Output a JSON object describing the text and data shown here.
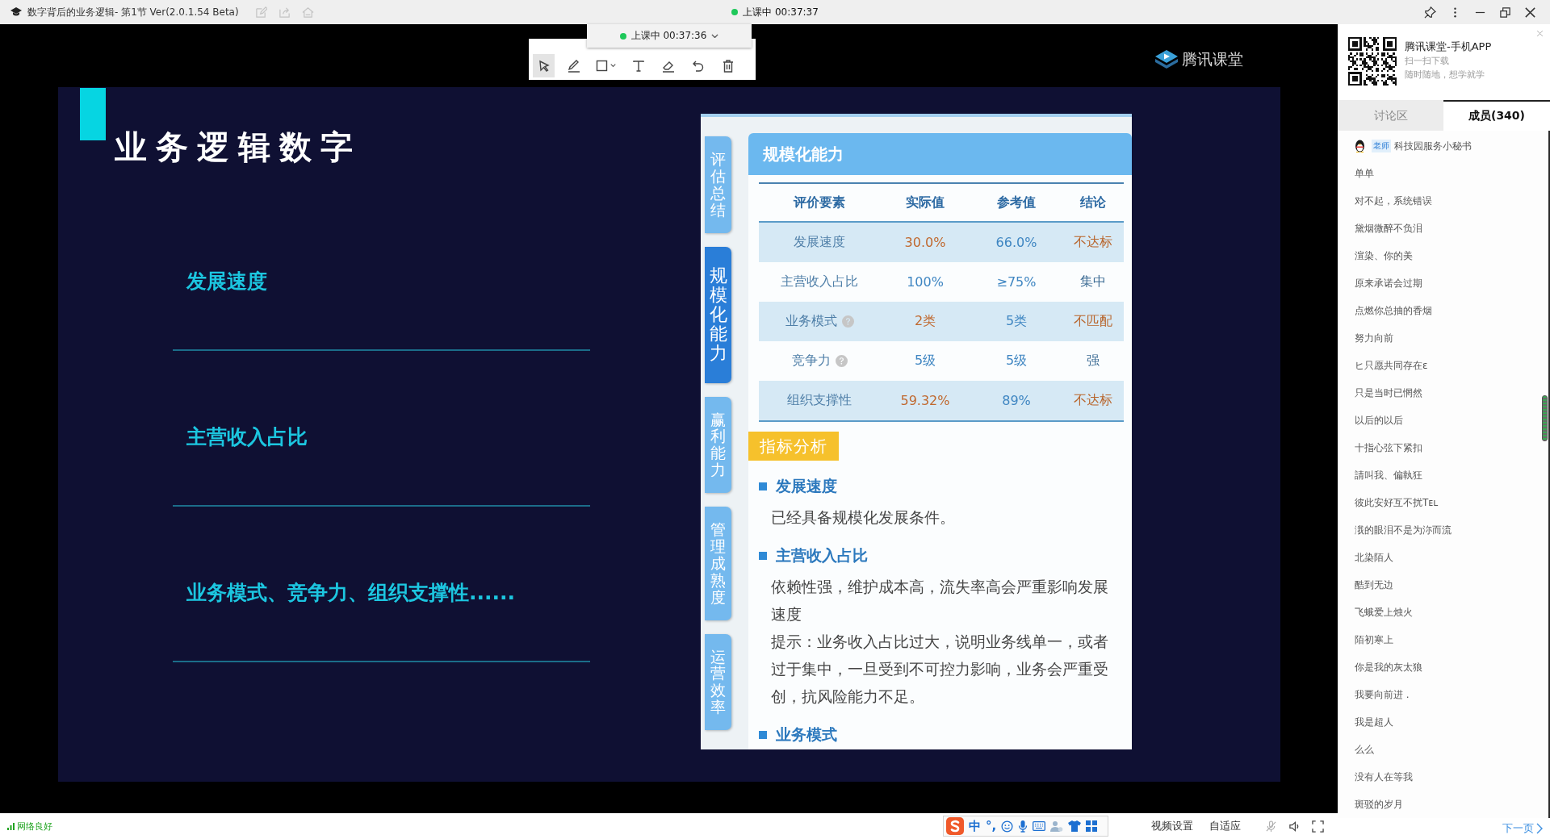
{
  "window": {
    "title": "数字背后的业务逻辑- 第1节 Ver(2.0.1.54 Beta)",
    "status": "上课中 00:37:37"
  },
  "class_timer": {
    "label": "上课中 00:37:36"
  },
  "whiteboard_tools": [
    {
      "kind": "pointer",
      "selected": true
    },
    {
      "kind": "pen",
      "selected": false
    },
    {
      "kind": "rectangle",
      "selected": false
    },
    {
      "kind": "text",
      "selected": false
    },
    {
      "kind": "eraser",
      "selected": false
    },
    {
      "kind": "undo",
      "selected": false
    },
    {
      "kind": "delete",
      "selected": false
    }
  ],
  "logo": {
    "text": "腾讯课堂"
  },
  "slide": {
    "title": "业务逻辑数字",
    "items": [
      "发展速度",
      "主营收入占比",
      "业务模式、竞争力、组织支撑性......"
    ]
  },
  "screenshot": {
    "side_tabs": [
      {
        "label": "评估总结",
        "selected": false
      },
      {
        "label": "规模化能力",
        "selected": true
      },
      {
        "label": "赢利能力",
        "selected": false
      },
      {
        "label": "管理成熟度",
        "selected": false
      },
      {
        "label": "运营效率",
        "selected": false
      }
    ],
    "card": {
      "title": "规模化能力",
      "table": {
        "columns": [
          "评价要素",
          "实际值",
          "参考值",
          "结论"
        ],
        "rows": [
          {
            "cells": [
              "发展速度",
              "30.0%",
              "66.0%",
              "不达标"
            ],
            "help": false,
            "meets_reference": false
          },
          {
            "cells": [
              "主营收入占比",
              "100%",
              "≥75%",
              "集中"
            ],
            "help": false,
            "meets_reference": true
          },
          {
            "cells": [
              "业务模式",
              "2类",
              "5类",
              "不匹配"
            ],
            "help": true,
            "meets_reference": false
          },
          {
            "cells": [
              "竞争力",
              "5级",
              "5级",
              "强"
            ],
            "help": true,
            "meets_reference": true
          },
          {
            "cells": [
              "组织支撑性",
              "59.32%",
              "89%",
              "不达标"
            ],
            "help": false,
            "meets_reference": false
          }
        ]
      }
    },
    "analysis": {
      "tag": "指标分析",
      "sections": [
        {
          "heading": "发展速度",
          "paragraphs": [
            "已经具备规模化发展条件。"
          ]
        },
        {
          "heading": "主营收入占比",
          "paragraphs": [
            "依赖性强，维护成本高，流失率高会严重影响发展速度",
            "提示：业务收入占比过大，说明业务线单一，或者过于集中，一旦受到不可控力影响，业务会严重受创，抗风险能力不足。"
          ]
        },
        {
          "heading": "业务模式"
        }
      ]
    }
  },
  "sidebar": {
    "promo": {
      "title": "腾讯课堂-手机APP",
      "lines": [
        "扫一扫下载",
        "随时随地，想学就学"
      ]
    },
    "tabs": [
      {
        "label": "讨论区",
        "selected": false
      },
      {
        "label": "成员(340)",
        "selected": true
      }
    ],
    "members": [
      {
        "kind": "teacher",
        "role": "老师",
        "name": "科技园服务小秘书"
      },
      {
        "kind": "student",
        "name": "单单"
      },
      {
        "kind": "student",
        "name": "对不起，系统错误"
      },
      {
        "kind": "student",
        "name": "黛烟微醉不负泪"
      },
      {
        "kind": "student",
        "name": "渲染、你的美"
      },
      {
        "kind": "student",
        "name": "原来承诺会过期"
      },
      {
        "kind": "student",
        "name": "点燃你总抽的香烟"
      },
      {
        "kind": "student",
        "name": "努力向前"
      },
      {
        "kind": "student",
        "name": "ヒ只愿共同存在ε"
      },
      {
        "kind": "student",
        "name": "只是当时已惘然"
      },
      {
        "kind": "student",
        "name": "以后的以后"
      },
      {
        "kind": "student",
        "name": "十指心弦下紧扣"
      },
      {
        "kind": "student",
        "name": "請叫我、偏執狂"
      },
      {
        "kind": "student",
        "name": "彼此安好互不扰Tᴇʟ"
      },
      {
        "kind": "student",
        "name": "涐的眼泪不是为沵而流"
      },
      {
        "kind": "student",
        "name": "北染陌人"
      },
      {
        "kind": "student",
        "name": "酷到无边"
      },
      {
        "kind": "student",
        "name": "飞蛾爱上烛火"
      },
      {
        "kind": "student",
        "name": "陌初寒上"
      },
      {
        "kind": "student",
        "name": "你是我的灰太狼"
      },
      {
        "kind": "student",
        "name": "我要向前进 ."
      },
      {
        "kind": "student",
        "name": "我是超人"
      },
      {
        "kind": "student",
        "name": "么么"
      },
      {
        "kind": "student",
        "name": "没有人在等我"
      },
      {
        "kind": "student",
        "name": "斑驳的岁月"
      }
    ],
    "next_page": "下一页"
  },
  "status_bar": {
    "network": "网络良好",
    "ime": {
      "mode": "中",
      "punctuation": "°,"
    },
    "buttons": [
      "视频设置",
      "自适应"
    ]
  }
}
